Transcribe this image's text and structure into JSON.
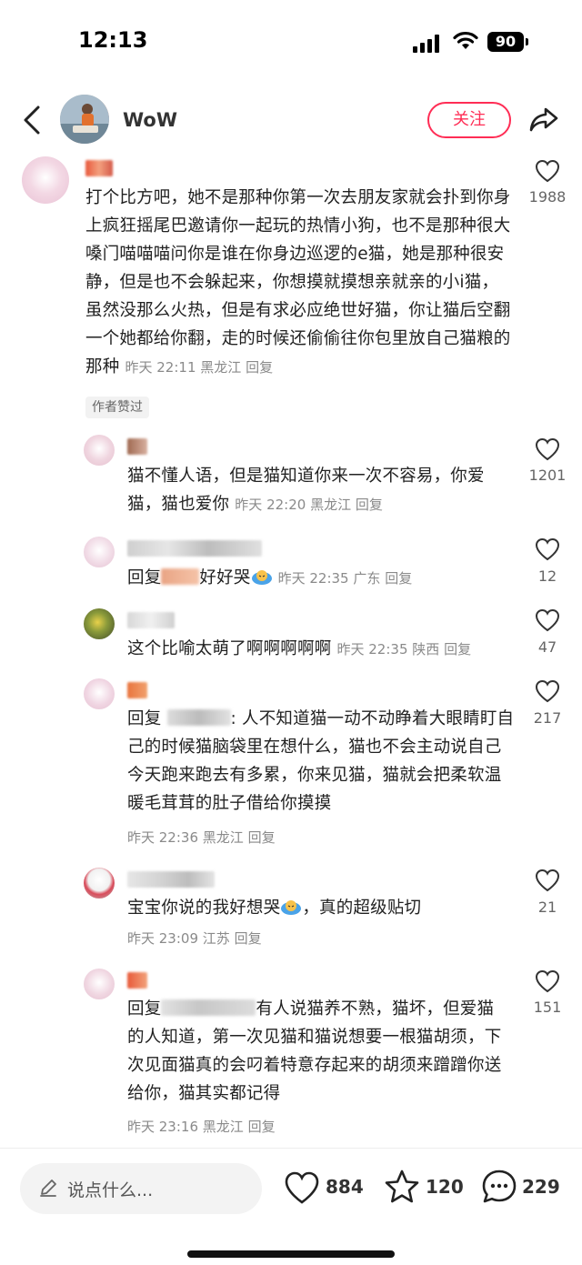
{
  "status_bar": {
    "time": "12:13",
    "battery": "90"
  },
  "nav": {
    "username": "WoW",
    "follow_label": "关注"
  },
  "comments": [
    {
      "text": "打个比方吧，她不是那种你第一次去朋友家就会扑到你身上疯狂摇尾巴邀请你一起玩的热情小狗，也不是那种很大嗓门喵喵喵问你是谁在你身边巡逻的e猫，她是那种很安静，但是也不会躲起来，你想摸就摸想亲就亲的小i猫，虽然没那么火热，但是有求必应绝世好猫，你让猫后空翻一个她都给你翻，走的时候还偷偷往你包里放自己猫粮的那种",
      "time": "昨天 22:11",
      "location": "黑龙江",
      "reply": "回复",
      "likes": "1988",
      "tag": "作者赞过"
    },
    {
      "text": "猫不懂人语，但是猫知道你来一次不容易，你爱猫，猫也爱你",
      "time": "昨天 22:20",
      "location": "黑龙江",
      "reply": "回复",
      "likes": "1201"
    },
    {
      "prefix": "回复",
      "text": "好好哭",
      "time": "昨天 22:35",
      "location": "广东",
      "reply": "回复",
      "likes": "12"
    },
    {
      "text": "这个比喻太萌了啊啊啊啊啊",
      "time": "昨天 22:35",
      "location": "陕西",
      "reply": "回复",
      "likes": "47"
    },
    {
      "prefix": "回复",
      "text": ": 人不知道猫一动不动睁着大眼睛盯自己的时候猫脑袋里在想什么，猫也不会主动说自己今天跑来跑去有多累，你来见猫，猫就会把柔软温暖毛茸茸的肚子借给你摸摸",
      "time": "昨天 22:36",
      "location": "黑龙江",
      "reply": "回复",
      "likes": "217"
    },
    {
      "text": "宝宝你说的我好想哭",
      "text_after": "，真的超级贴切",
      "time": "昨天 23:09",
      "location": "江苏",
      "reply": "回复",
      "likes": "21"
    },
    {
      "prefix": "回复",
      "text": "有人说猫养不熟，猫坏，但爱猫的人知道，第一次见猫和猫说想要一根猫胡须，下次见面猫真的会叼着特意存起来的胡须来蹭蹭你送给你，猫其实都记得",
      "time": "昨天 23:16",
      "location": "黑龙江",
      "reply": "回复",
      "likes": "151"
    }
  ],
  "bottom_bar": {
    "placeholder": "说点什么...",
    "likes": "884",
    "stars": "120",
    "comments": "229"
  },
  "colors": {
    "accent": "#ff2d55",
    "meta": "#8a8a8a"
  }
}
